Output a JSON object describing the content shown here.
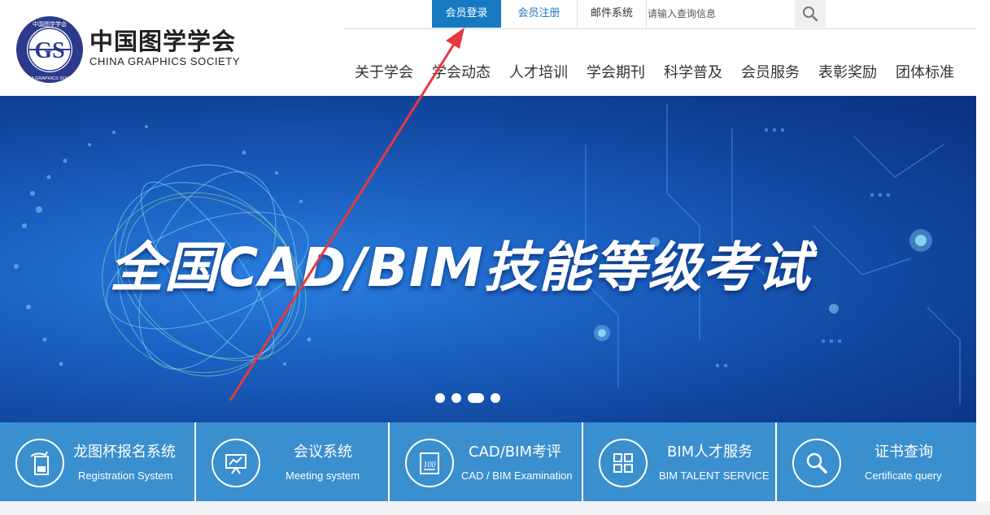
{
  "logo": {
    "cn": "中国图学学会",
    "en": "CHINA GRAPHICS SOCIETY",
    "emblem_top": "中国图学学会",
    "emblem_bottom": "CHINA GRAPHICS SOCIETY",
    "emblem_letters": "GS"
  },
  "topbar": {
    "login": "会员登录",
    "register": "会员注册",
    "mail": "邮件系统",
    "search_placeholder": "请输入查询信息"
  },
  "nav": [
    "关于学会",
    "学会动态",
    "人才培训",
    "学会期刊",
    "科学普及",
    "会员服务",
    "表彰奖励",
    "团体标准"
  ],
  "banner": {
    "title": "全国CAD/BIM技能等级考试",
    "slides": 4,
    "active_slide": 3
  },
  "services": [
    {
      "cn": "龙图杯报名系统",
      "en": "Registration System",
      "icon": "registration-icon"
    },
    {
      "cn": "会议系统",
      "en": "Meeting system",
      "icon": "presentation-icon"
    },
    {
      "cn": "CAD/BIM考评",
      "en": "CAD / BIM Examination",
      "icon": "exam-score-icon"
    },
    {
      "cn": "BIM人才服务",
      "en": "BIM TALENT SERVICE",
      "icon": "grid-apps-icon"
    },
    {
      "cn": "证书查询",
      "en": "Certificate query",
      "icon": "search-icon"
    }
  ],
  "colors": {
    "accent": "#1779c2",
    "service_bar": "#3a8fcf",
    "annotation_arrow": "#e8383d"
  }
}
